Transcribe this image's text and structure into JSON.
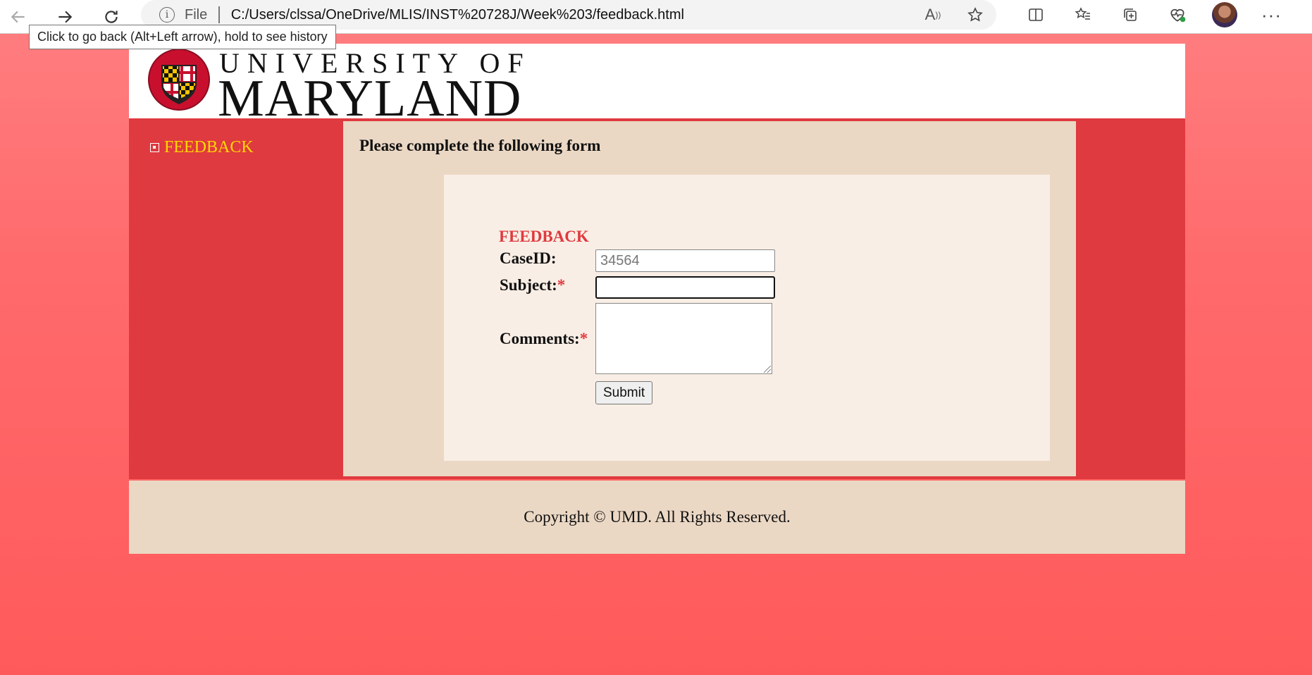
{
  "browser": {
    "address_scheme": "File",
    "address_url": "C:/Users/clssa/OneDrive/MLIS/INST%20728J/Week%203/feedback.html",
    "tooltip": "Click to go back (Alt+Left arrow), hold to see history",
    "icons": [
      "back-icon",
      "forward-icon",
      "refresh-icon",
      "info-icon",
      "read-aloud-icon",
      "favorite-star-icon",
      "split-screen-icon",
      "favorites-icon",
      "collections-icon",
      "browser-essentials-icon",
      "profile-avatar",
      "more-icon"
    ]
  },
  "header": {
    "logo_line1": "UNIVERSITY OF",
    "logo_line2": "MARYLAND"
  },
  "sidebar": {
    "items": [
      {
        "label": "FEEDBACK"
      }
    ]
  },
  "main": {
    "title": "Please complete the following form",
    "form": {
      "heading": "FEEDBACK",
      "caseid_label": "CaseID:",
      "caseid_placeholder": "34564",
      "subject_label": "Subject:",
      "subject_value": "",
      "comments_label": "Comments:",
      "required_marker": "*",
      "submit_label": "Submit"
    }
  },
  "footer": {
    "text": "Copyright © UMD. All Rights Reserved."
  },
  "colors": {
    "brand_red": "#df3a3f",
    "brand_gold": "#ffd700",
    "panel_tan": "#ebd8c4"
  }
}
